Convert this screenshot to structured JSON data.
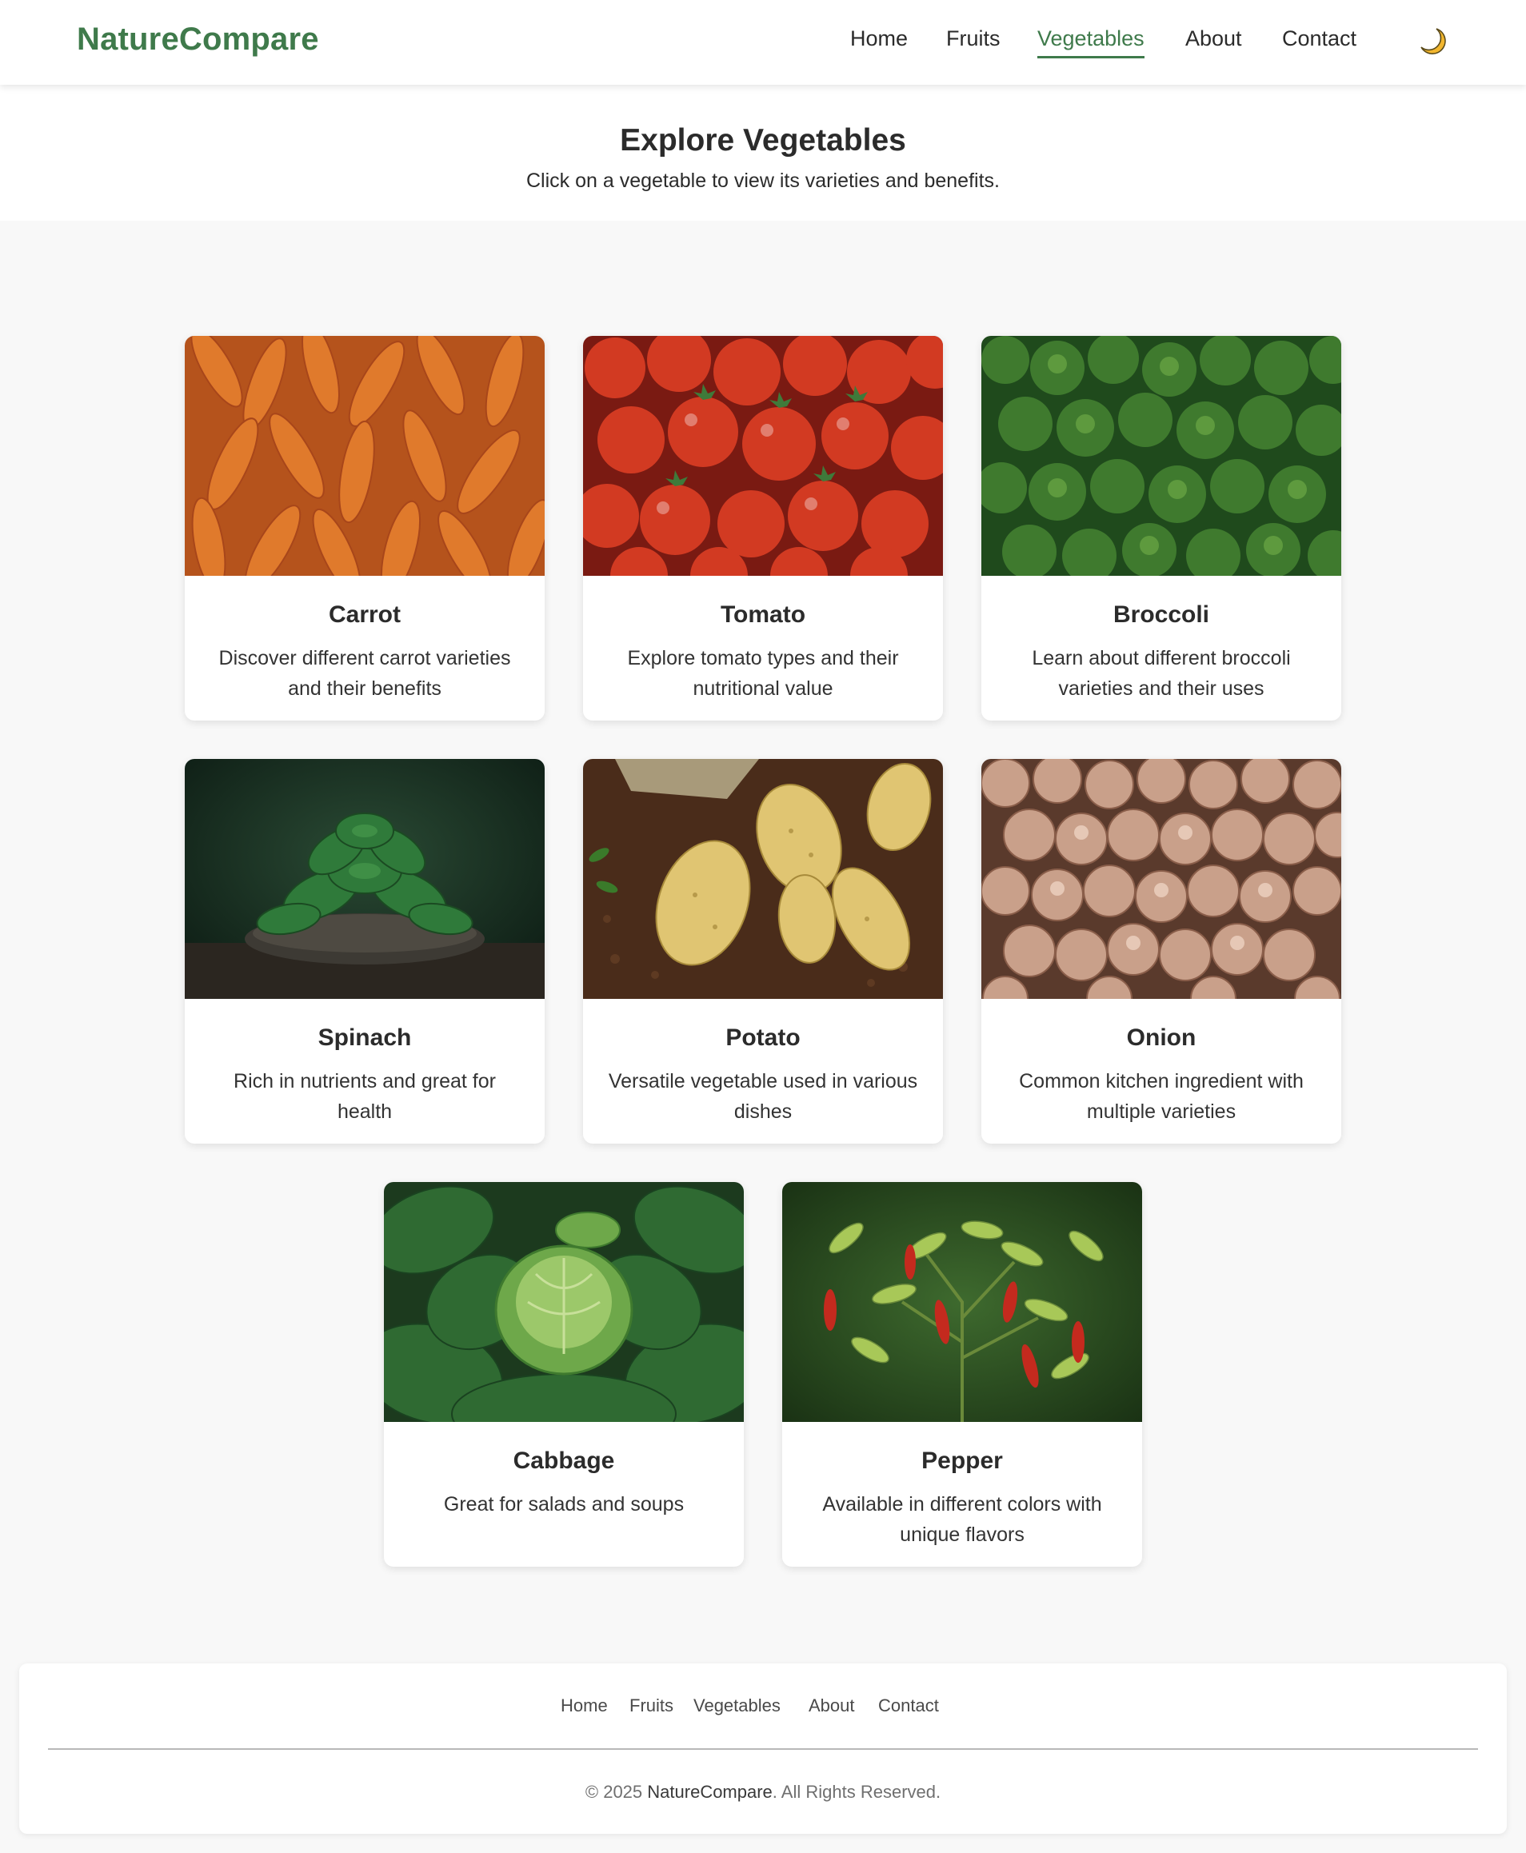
{
  "header": {
    "logo": "NatureCompare",
    "nav": [
      {
        "label": "Home"
      },
      {
        "label": "Fruits"
      },
      {
        "label": "Vegetables",
        "active": true
      },
      {
        "label": "About"
      },
      {
        "label": "Contact"
      }
    ],
    "theme_toggle_icon": "moon-icon"
  },
  "hero": {
    "title": "Explore Vegetables",
    "subtitle": "Click on a vegetable to view its varieties and benefits."
  },
  "vegetables": [
    {
      "name": "Carrot",
      "description": "Discover different carrot varieties and their benefits"
    },
    {
      "name": "Tomato",
      "description": "Explore tomato types and their nutritional value"
    },
    {
      "name": "Broccoli",
      "description": "Learn about different broccoli varieties and their uses"
    },
    {
      "name": "Spinach",
      "description": "Rich in nutrients and great for health"
    },
    {
      "name": "Potato",
      "description": "Versatile vegetable used in various dishes"
    },
    {
      "name": "Onion",
      "description": "Common kitchen ingredient with multiple varieties"
    },
    {
      "name": "Cabbage",
      "description": "Great for salads and soups"
    },
    {
      "name": "Pepper",
      "description": "Available in different colors with unique flavors"
    }
  ],
  "footer": {
    "nav": [
      {
        "label": "Home"
      },
      {
        "label": "Fruits"
      },
      {
        "label": "Vegetables"
      },
      {
        "label": "About"
      },
      {
        "label": "Contact"
      }
    ],
    "copyright_prefix": "© 2025 ",
    "copyright_brand": "NatureCompare",
    "copyright_suffix": ". All Rights Reserved."
  },
  "colors": {
    "brand": "#3f7a4b",
    "background": "#f8f8f8",
    "card": "#ffffff",
    "text": "#2b2b2b"
  }
}
